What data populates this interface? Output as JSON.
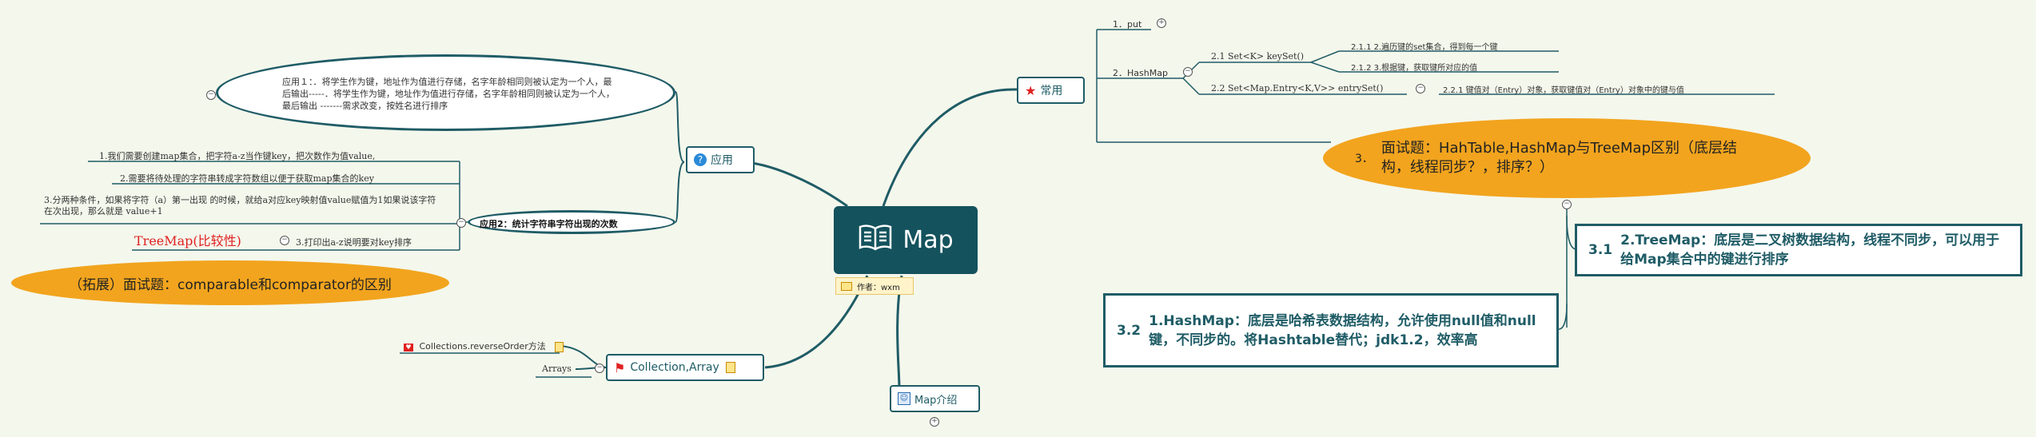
{
  "central": {
    "title": "Map"
  },
  "author": {
    "label": "作者：wxm"
  },
  "branches": {
    "common": {
      "label": "常用",
      "put": "1．put",
      "hashmap": "2．HashMap",
      "keyset": "2.1  Set<K> keySet()",
      "keyset_1": "2.1.1  2.遍历键的set集合，得到每一个键",
      "keyset_2": "2.1.2  3.根据键，获取键所对应的值",
      "entryset": "2.2  Set<Map.Entry<K,V>> entrySet()",
      "entryset_1": "2.2.1  键值对（Entry）对象，获取键值对（Entry）对象中的键与值",
      "interview3_num": "3．",
      "interview3_text": "面试题：HahTable,HashMap与TreeMap区别（底层结构，线程同步？，排序？）",
      "treemap_num": "3.1",
      "treemap_text": "2.TreeMap：底层是二叉树数据结构，线程不同步，可以用于给Map集合中的键进行排序",
      "hashmap32_num": "3.2",
      "hashmap32_text": "1.HashMap：底层是哈希表数据结构，允许使用null值和null键，不同步的。将Hashtable替代；jdk1.2，效率高"
    },
    "application": {
      "label": "应用",
      "app1": "应用１：．将学生作为键，地址作为值进行存储，名字年龄相同则被认定为一个人，最后输出-----．将学生作为键，地址作为值进行存储，名字年龄相同则被认定为一个人，最后输出 -------需求改变，按姓名进行排序",
      "app2": "应用2：统计字符串字符出现的次数",
      "step1": "1.我们需要创建map集合，把字符a-z当作键key，把次数作为值value,",
      "step2": "2.需要将待处理的字符串转成字符数组以便于获取map集合的key",
      "step3": "3.分两种条件，如果将字符（a）第一出现 的时候，就给a对应key映射值value赋值为1如果说该字符在次出现，那么就是 value+1",
      "step4": "3.打印出a-z说明要对key排序",
      "treemap_red": "TreeMap(比较性)",
      "ext_interview": "（拓展）面试题：comparable和comparator的区别"
    },
    "collection": {
      "label": "Collection,Array",
      "reverse": "Collections.reverseOrder方法",
      "arrays": "Arrays"
    },
    "intro": {
      "label": "Map介绍"
    }
  },
  "colors": {
    "teal": "#1f5c66",
    "orange": "#f2a41e",
    "red": "#e02020",
    "central": "#14525d"
  }
}
